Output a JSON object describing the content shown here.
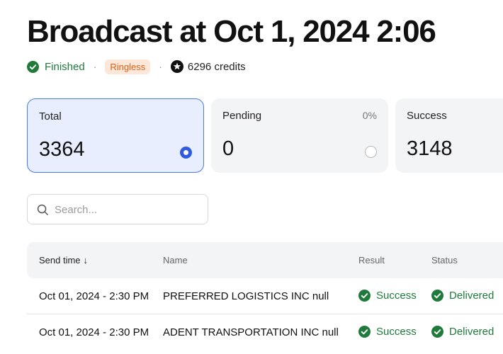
{
  "header": {
    "title": "Broadcast at Oct 1, 2024 2:06",
    "status": "Finished",
    "type_badge": "Ringless",
    "credits": "6296 credits"
  },
  "stats": [
    {
      "label": "Total",
      "value": "3364",
      "percent": "",
      "selected": true
    },
    {
      "label": "Pending",
      "value": "0",
      "percent": "0%",
      "selected": false
    },
    {
      "label": "Success",
      "value": "3148",
      "percent": "",
      "selected": false
    }
  ],
  "search": {
    "placeholder": "Search...",
    "value": ""
  },
  "table": {
    "columns": {
      "send_time": "Send time",
      "send_time_sort": "↓",
      "name": "Name",
      "result": "Result",
      "status": "Status"
    },
    "rows": [
      {
        "send_time": "Oct 01, 2024 - 2:30 PM",
        "name": "PREFERRED LOGISTICS INC null",
        "result": "Success",
        "status": "Delivered"
      },
      {
        "send_time": "Oct 01, 2024 - 2:30 PM",
        "name": "ADENT TRANSPORTATION INC null",
        "result": "Success",
        "status": "Delivered"
      }
    ]
  },
  "colors": {
    "accent": "#2e5be0",
    "success": "#1f7a3b",
    "badge_text": "#d9611a",
    "badge_bg": "#fde7d8"
  }
}
